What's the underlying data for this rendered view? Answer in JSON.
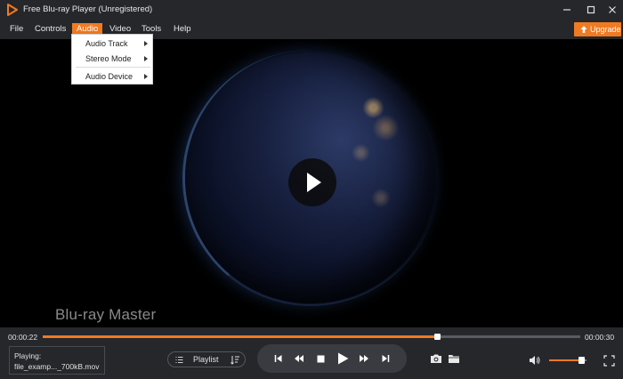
{
  "window": {
    "title": "Free Blu-ray Player (Unregistered)"
  },
  "menu": {
    "items": [
      {
        "label": "File"
      },
      {
        "label": "Controls"
      },
      {
        "label": "Audio",
        "active": true
      },
      {
        "label": "Video"
      },
      {
        "label": "Tools"
      },
      {
        "label": "Help"
      }
    ],
    "upgrade_label": "Upgrade"
  },
  "audio_menu": {
    "items": [
      {
        "label": "Audio Track",
        "submenu": true
      },
      {
        "label": "Stereo Mode",
        "submenu": true
      },
      {
        "label": "Audio Device",
        "submenu": true
      }
    ]
  },
  "video": {
    "watermark": "Blu-ray Master"
  },
  "playback": {
    "current_time": "00:00:22",
    "total_time": "00:00:30",
    "progress": 0.733,
    "now_playing_label": "Playing:",
    "now_playing_file": "file_examp..._700kB.mov",
    "playlist_label": "Playlist",
    "volume": 0.85
  },
  "colors": {
    "accent": "#f07a22",
    "background": "#26272b",
    "video": "#000000"
  },
  "icons": [
    "app-logo-icon",
    "minimize-icon",
    "maximize-icon",
    "close-icon",
    "upgrade-arrow-icon",
    "play-icon",
    "list-icon",
    "sort-icon",
    "skip-back-icon",
    "rewind-icon",
    "stop-icon",
    "fast-forward-icon",
    "skip-forward-icon",
    "snapshot-icon",
    "folder-icon",
    "volume-icon",
    "fullscreen-icon"
  ]
}
